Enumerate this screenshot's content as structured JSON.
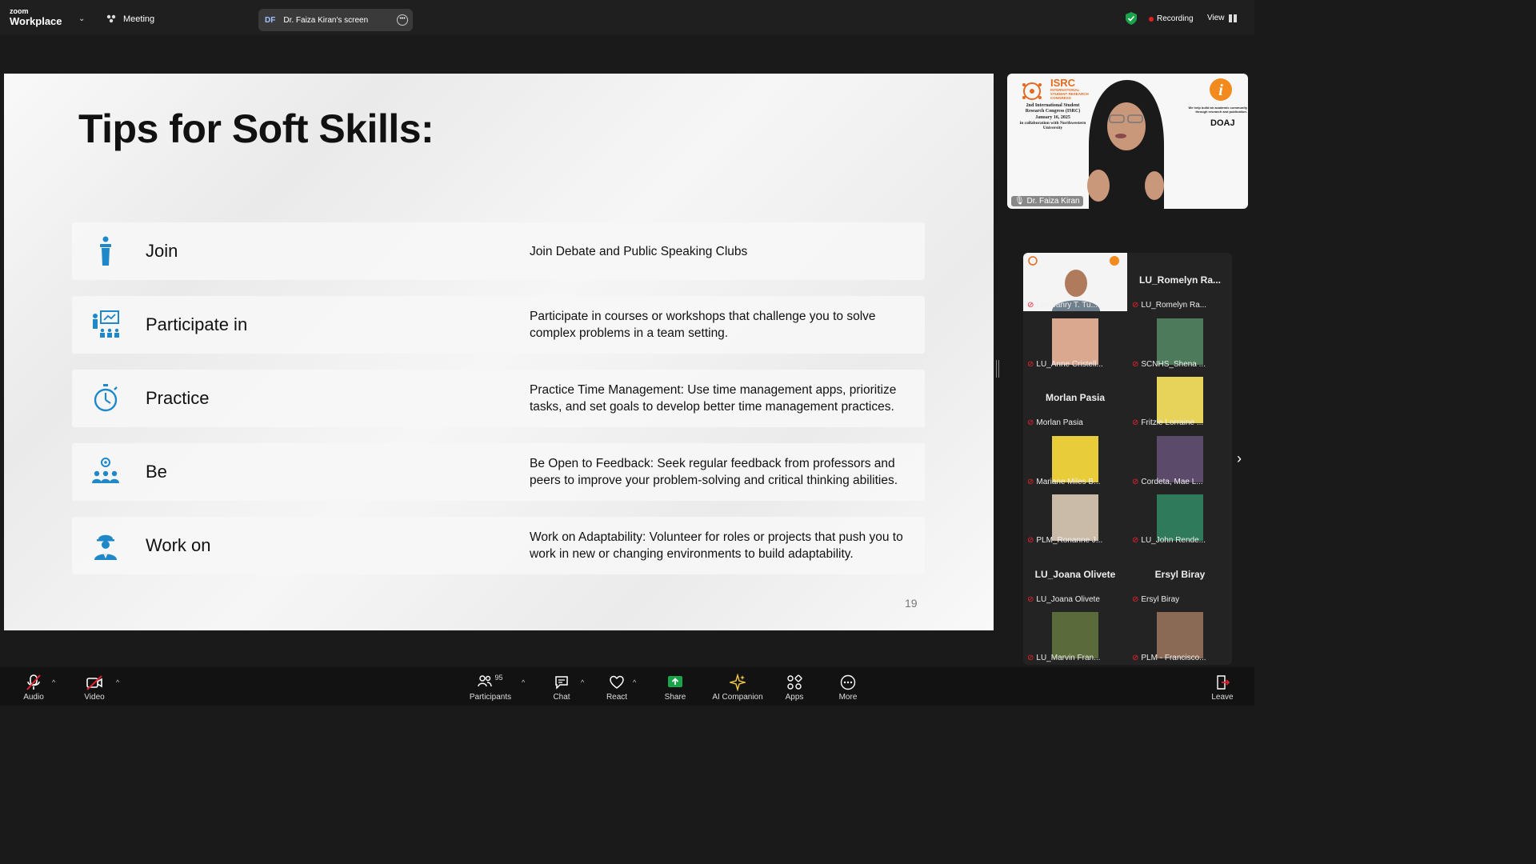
{
  "topbar": {
    "brand_small": "zoom",
    "brand": "Workplace",
    "meeting": "Meeting",
    "share_initials": "DF",
    "share_title": "Dr. Faiza Kiran's screen",
    "recording": "Recording",
    "view": "View"
  },
  "slide": {
    "title": "Tips for Soft Skills:",
    "rows": [
      {
        "label": "Join",
        "desc": "Join Debate and Public Speaking Clubs",
        "icon": "podium-icon"
      },
      {
        "label": "Participate in",
        "desc": "Participate in courses or workshops that challenge you to solve complex problems in a team setting.",
        "icon": "presentation-icon"
      },
      {
        "label": "Practice",
        "desc": "Practice Time Management: Use time management apps, prioritize tasks, and set goals to develop better time management practices.",
        "icon": "stopwatch-icon"
      },
      {
        "label": "Be",
        "desc": "Be Open to Feedback: Seek regular feedback from professors and peers to improve your problem-solving and critical thinking abilities.",
        "icon": "team-icon"
      },
      {
        "label": "Work on",
        "desc": "Work on Adaptability: Volunteer for roles or projects that push you to work in new or changing environments to build adaptability.",
        "icon": "worker-icon"
      }
    ],
    "page_number": "19"
  },
  "speaker": {
    "name": "Dr. Faiza Kiran",
    "banner_title": "ISRC",
    "banner_subtitle": "INTERNATIONAL STUDENT RESEARCH CONGRESS",
    "banner_line1": "2nd International Student Research Congress (ISRC)",
    "banner_line2": "January 16, 2025",
    "banner_line3": "in collaboration with Northwestern University",
    "banner_right": "We help build an academic community through research and publication.",
    "doaj": "DOAJ"
  },
  "participants": [
    {
      "name": "Leo Janry T. Tu...",
      "big": "",
      "video": true
    },
    {
      "name": "LU_Romelyn Ra...",
      "big": "LU_Romelyn Ra...",
      "video": false
    },
    {
      "name": "LU_Anne Cristell...",
      "big": "",
      "video": true
    },
    {
      "name": "SCNHS_Shena ...",
      "big": "",
      "video": true
    },
    {
      "name": "Morlan Pasia",
      "big": "Morlan Pasia",
      "video": false
    },
    {
      "name": "Fritzie Lorraine ...",
      "big": "",
      "video": true
    },
    {
      "name": "Mariane Miles B...",
      "big": "",
      "video": true
    },
    {
      "name": "Cordeta, Mae L...",
      "big": "",
      "video": true
    },
    {
      "name": "PLM_Ronanne J...",
      "big": "",
      "video": true
    },
    {
      "name": "LU_John Rende...",
      "big": "",
      "video": true
    },
    {
      "name": "LU_Joana Olivete",
      "big": "LU_Joana Olivete",
      "video": false
    },
    {
      "name": "Ersyl Biray",
      "big": "Ersyl Biray",
      "video": false
    },
    {
      "name": "LU_Marvin Fran...",
      "big": "",
      "video": true
    },
    {
      "name": "PLM - Francisco...",
      "big": "",
      "video": true
    }
  ],
  "toolbar": {
    "audio": "Audio",
    "video": "Video",
    "participants": "Participants",
    "participants_count": "95",
    "chat": "Chat",
    "react": "React",
    "share": "Share",
    "ai": "AI Companion",
    "apps": "Apps",
    "more": "More",
    "leave": "Leave"
  },
  "colors": {
    "accent_blue": "#1e88c8",
    "share_green": "#19a34a",
    "recording_red": "#e02020",
    "mute_red": "#e02233"
  }
}
